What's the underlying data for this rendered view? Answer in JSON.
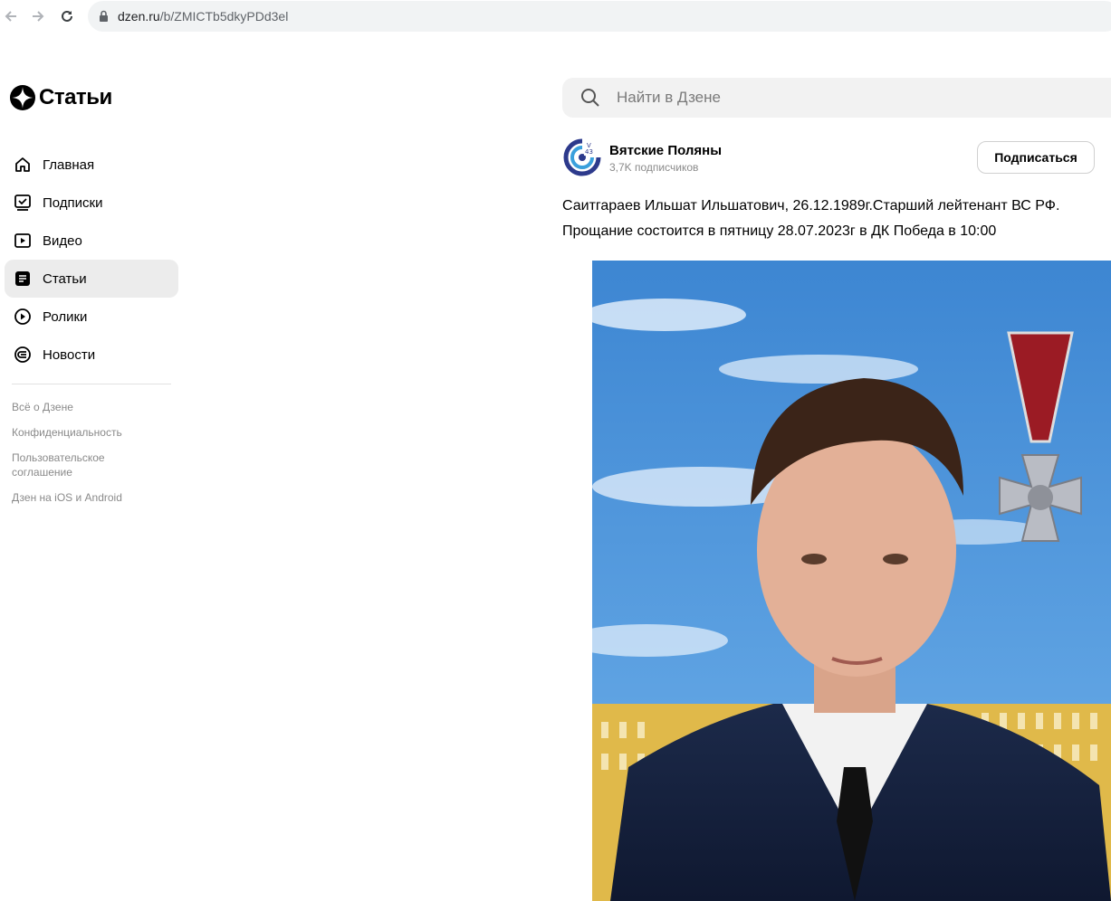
{
  "browser": {
    "url_host": "dzen.ru",
    "url_path": "/b/ZMICTb5dkyPDd3el"
  },
  "sidebar": {
    "logo_title": "Статьи",
    "items": [
      {
        "label": "Главная",
        "icon": "home-icon"
      },
      {
        "label": "Подписки",
        "icon": "subscriptions-icon"
      },
      {
        "label": "Видео",
        "icon": "video-icon"
      },
      {
        "label": "Статьи",
        "icon": "articles-icon",
        "active": true
      },
      {
        "label": "Ролики",
        "icon": "shorts-icon"
      },
      {
        "label": "Новости",
        "icon": "news-icon"
      }
    ],
    "footer_links": [
      "Всё о Дзене",
      "Конфиденциальность",
      "Пользовательское соглашение",
      "Дзен на iOS и Android"
    ]
  },
  "search": {
    "placeholder": "Найти в Дзене"
  },
  "channel": {
    "name": "Вятские Поляны",
    "subscribers": "3,7K подписчиков",
    "subscribe_label": "Подписаться"
  },
  "article": {
    "line1": "Саитгараев Ильшат Ильшатович, 26.12.1989г.Старший лейтенант ВС РФ.",
    "line2": "Прощание состоится в пятницу 28.07.2023г в ДК Победа в 10:00"
  },
  "colors": {
    "accent": "#000000",
    "active_bg": "#ececec",
    "muted_text": "#8a8a8a",
    "sky": "#4a8fd6"
  }
}
